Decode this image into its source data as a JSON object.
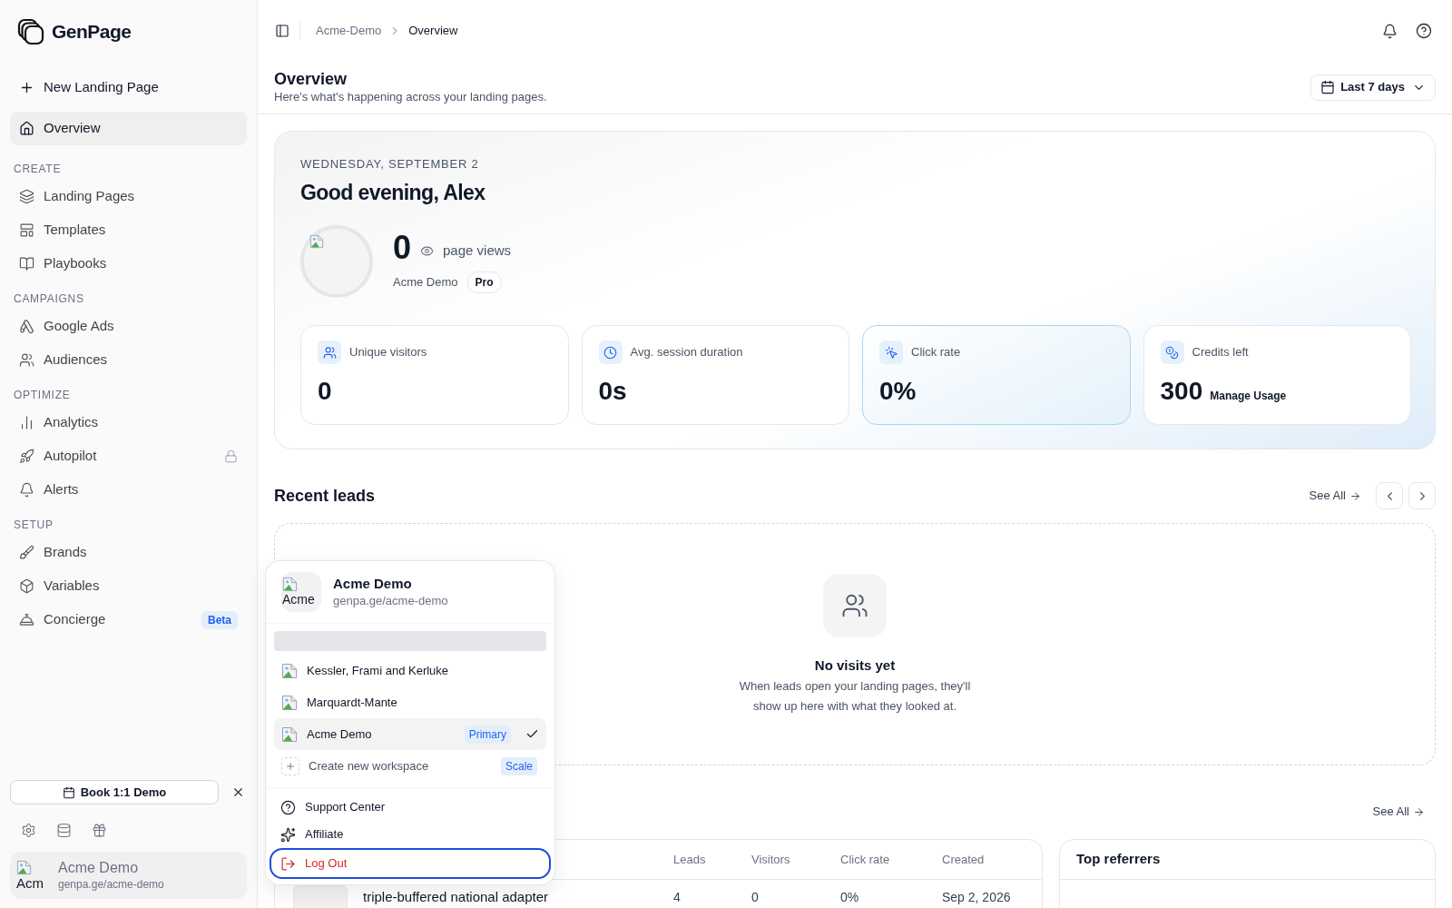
{
  "sidebar": {
    "logo": "GenPage",
    "new_button": "New Landing Page",
    "overview": {
      "label": "Overview",
      "selected": true
    },
    "sections": [
      {
        "title": "CREATE",
        "items": [
          {
            "label": "Landing Pages",
            "selected": false,
            "locked": false
          },
          {
            "label": "Templates",
            "selected": false,
            "locked": false
          },
          {
            "label": "Playbooks",
            "selected": false,
            "locked": false
          }
        ]
      },
      {
        "title": "CAMPAIGNS",
        "items": [
          {
            "label": "Google Ads",
            "selected": false,
            "locked": false
          },
          {
            "label": "Audiences",
            "selected": false,
            "locked": false
          }
        ]
      },
      {
        "title": "OPTIMIZE",
        "items": [
          {
            "label": "Analytics",
            "selected": false,
            "locked": false
          },
          {
            "label": "Autopilot",
            "selected": false,
            "locked": true
          },
          {
            "label": "Alerts",
            "selected": false,
            "locked": false
          }
        ]
      },
      {
        "title": "SETUP",
        "items": [
          {
            "label": "Brands",
            "selected": false,
            "locked": false
          },
          {
            "label": "Variables",
            "selected": false,
            "locked": false
          },
          {
            "label": "Concierge",
            "selected": false,
            "locked": false,
            "badge": "Beta"
          }
        ]
      }
    ],
    "demo_button": "Book 1:1 Demo",
    "account": {
      "avatar_alt": "Acm",
      "name": "Acme Demo",
      "url": "genpa.ge/acme-demo"
    }
  },
  "breadcrumb": [
    {
      "label": "Acme-Demo",
      "current": false
    },
    {
      "label": "Overview",
      "current": true
    }
  ],
  "page_header": {
    "title": "Overview",
    "subtitle": "Here's what's happening across your landing pages.",
    "range": "Last 7 days"
  },
  "hero": {
    "date": "WEDNESDAY, SEPTEMBER 2",
    "greeting": "Good evening, Alex",
    "views": "0",
    "views_label": "page views",
    "workspace": "Acme Demo",
    "plan": "Pro"
  },
  "stats": [
    {
      "label": "Unique visitors",
      "value": "0",
      "highlighted": false
    },
    {
      "label": "Avg. session duration",
      "value": "0s",
      "highlighted": false
    },
    {
      "label": "Click rate",
      "value": "0%",
      "highlighted": true
    },
    {
      "label": "Credits left",
      "value": "300",
      "link": "Manage Usage",
      "highlighted": false
    }
  ],
  "recent_leads": {
    "title": "Recent leads",
    "see_all": "See All",
    "empty_title": "No visits yet",
    "empty_text": "When leads open your landing pages, they'll show up here with what they looked at."
  },
  "pages": {
    "see_all": "See All",
    "table": {
      "columns": [
        "Leads",
        "Visitors",
        "Click rate",
        "Created"
      ],
      "rows": [
        {
          "name": "triple-buffered national adapter",
          "cells": [
            "4",
            "0",
            "0%",
            "Sep 2, 2026"
          ]
        }
      ]
    }
  },
  "top_referrers": {
    "title": "Top referrers"
  },
  "workspace_menu": {
    "current": {
      "avatar_alt": "Acme",
      "name": "Acme Demo",
      "url": "genpa.ge/acme-demo"
    },
    "workspaces": [
      {
        "name": "Kessler, Frami and Kerluke",
        "selected": false
      },
      {
        "name": "Marquardt-Mante",
        "selected": false
      },
      {
        "name": "Acme Demo",
        "badge": "Primary",
        "selected": true
      }
    ],
    "create": {
      "label": "Create new workspace",
      "badge": "Scale"
    },
    "links": [
      {
        "label": "Support Center",
        "kind": "normal",
        "focused": false
      },
      {
        "label": "Affiliate",
        "kind": "normal",
        "focused": false
      },
      {
        "label": "Log Out",
        "kind": "danger",
        "focused": true
      }
    ]
  }
}
